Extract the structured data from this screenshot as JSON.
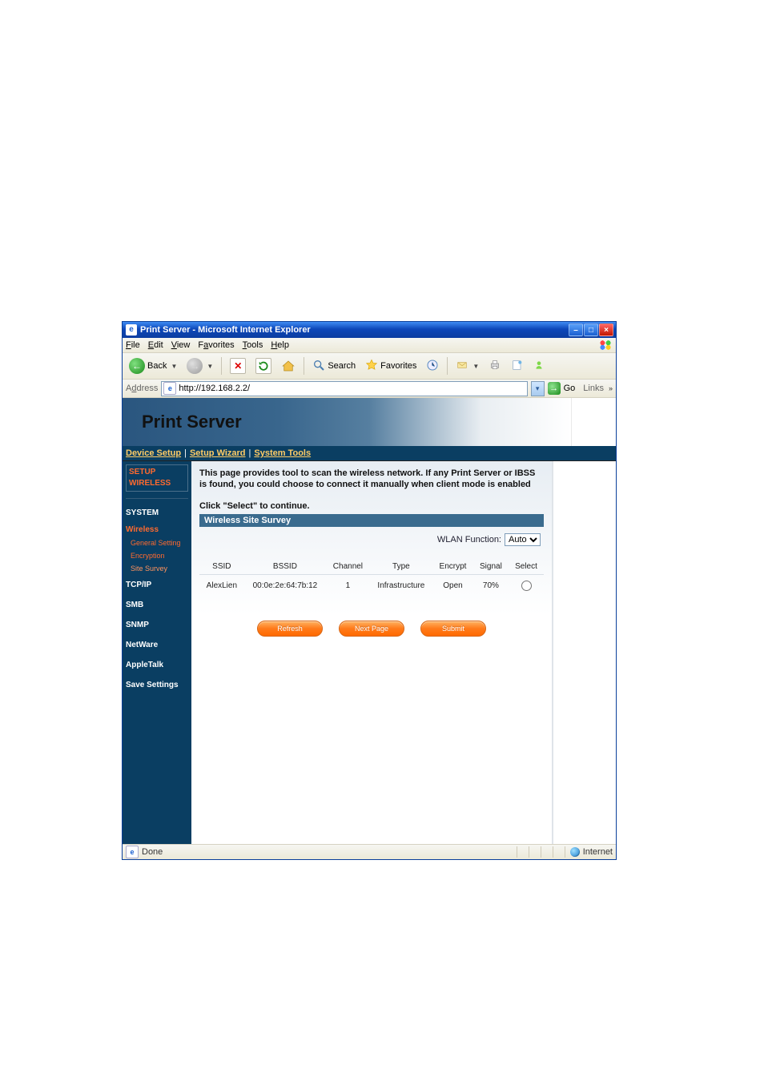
{
  "window": {
    "title": "Print Server - Microsoft Internet Explorer"
  },
  "menu": {
    "file": "File",
    "edit": "Edit",
    "view": "View",
    "favorites": "Favorites",
    "tools": "Tools",
    "help": "Help"
  },
  "toolbar": {
    "back": "Back",
    "search": "Search",
    "favorites": "Favorites"
  },
  "address": {
    "label": "Address",
    "value": "http://192.168.2.2/",
    "go": "Go",
    "links": "Links"
  },
  "banner": {
    "title": "Print Server"
  },
  "tabs": {
    "device_setup": "Device Setup",
    "setup_wizard": "Setup Wizard",
    "system_tools": "System Tools"
  },
  "sidebar": {
    "setup": "SETUP",
    "wireless_hdr": "WIRELESS",
    "system": "SYSTEM",
    "wireless": "Wireless",
    "general_setting": "General Setting",
    "encryption": "Encryption",
    "site_survey": "Site Survey",
    "tcpip": "TCP/IP",
    "smb": "SMB",
    "snmp": "SNMP",
    "netware": "NetWare",
    "appletalk": "AppleTalk",
    "save_settings": "Save Settings"
  },
  "page": {
    "desc": "This page provides tool to scan the wireless network. If any Print Server or IBSS is found, you could choose to connect it manually when client mode is enabled",
    "hint": "Click \"Select\" to continue.",
    "section": "Wireless Site Survey",
    "wlan_label": "WLAN Function:",
    "wlan_options": [
      "Auto"
    ],
    "wlan_selected": "Auto",
    "table": {
      "headers": {
        "ssid": "SSID",
        "bssid": "BSSID",
        "channel": "Channel",
        "type": "Type",
        "encrypt": "Encrypt",
        "signal": "Signal",
        "select": "Select"
      },
      "rows": [
        {
          "ssid": "AlexLien",
          "bssid": "00:0e:2e:64:7b:12",
          "channel": "1",
          "type": "Infrastructure",
          "encrypt": "Open",
          "signal": "70%"
        }
      ]
    },
    "buttons": {
      "refresh": "Refresh",
      "next_page": "Next Page",
      "submit": "Submit"
    }
  },
  "status": {
    "done": "Done",
    "zone": "Internet"
  }
}
